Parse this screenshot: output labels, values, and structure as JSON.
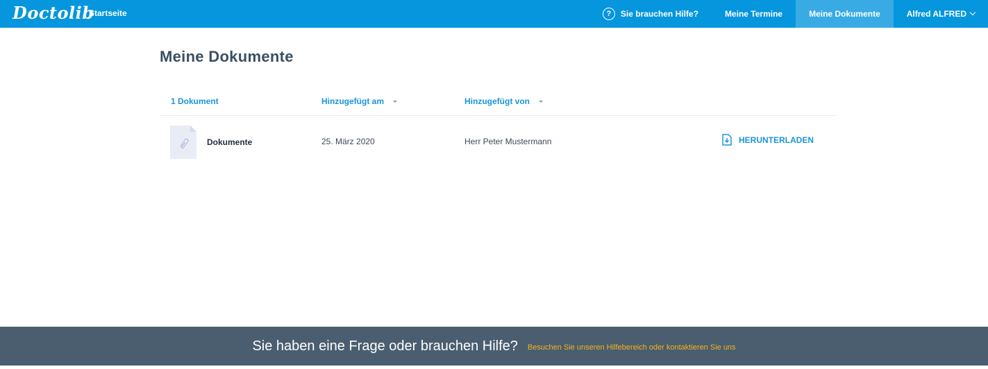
{
  "header": {
    "logo": "Doctolib",
    "home_label": "Startseite",
    "help_icon": "question-circle-icon",
    "help_label": "Sie brauchen Hilfe?",
    "appointments_label": "Meine Termine",
    "documents_label": "Meine Dokumente",
    "user_label": "Alfred ALFRED",
    "accent_color": "#0596de"
  },
  "main": {
    "title": "Meine Dokumente",
    "table": {
      "headers": {
        "count": "1 Dokument",
        "added_on": "Hinzugefügt am",
        "added_by": "Hinzugefügt von"
      },
      "rows": [
        {
          "name": "Dokumente",
          "date": "25. März 2020",
          "added_by": "Herr Peter Mustermann",
          "action": "HERUNTERLADEN"
        }
      ]
    }
  },
  "footer": {
    "question": "Sie haben eine Frage oder brauchen Hilfe?",
    "link": "Besuchen Sie unseren Hilfebereich oder kontaktieren Sie uns"
  }
}
